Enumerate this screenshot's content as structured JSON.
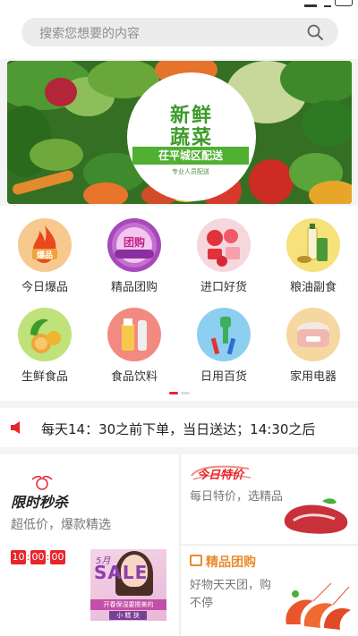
{
  "search": {
    "placeholder": "搜索您想要的内容",
    "icon": "search-icon"
  },
  "banner": {
    "line1": "新鲜",
    "line2": "蔬菜",
    "tag": "茌平城区配送",
    "small": "专业人员配送"
  },
  "categories": [
    {
      "label": "今日爆品",
      "icon": "fire-hot-icon",
      "badge": "爆品"
    },
    {
      "label": "精品团购",
      "icon": "group-buy-icon",
      "badge": "团购"
    },
    {
      "label": "进口好货",
      "icon": "imported-goods-icon"
    },
    {
      "label": "粮油副食",
      "icon": "grain-oil-icon"
    },
    {
      "label": "生鲜食品",
      "icon": "fresh-food-icon"
    },
    {
      "label": "食品饮料",
      "icon": "drinks-icon"
    },
    {
      "label": "日用百货",
      "icon": "daily-goods-icon"
    },
    {
      "label": "家用电器",
      "icon": "appliance-icon"
    }
  ],
  "notice": {
    "text": "每天14：30之前下单，当日送达；14:30之后",
    "icon": "speaker-icon"
  },
  "flash_sale": {
    "title": "限时秒杀",
    "subtitle": "超低价，爆款精选",
    "timer": {
      "hh": "10",
      "mm": "00",
      "ss": "00"
    },
    "ad": {
      "title": "5月",
      "big": "SALE",
      "bar": "开春保湿要擦美的",
      "bar2": "小 糕 抉"
    }
  },
  "daily_special": {
    "badge": "今日特价",
    "subtitle": "每日特价，选精品"
  },
  "group_buy": {
    "title": "精品团购",
    "line1": "好物天天团，购",
    "line2": "不停"
  },
  "colors": {
    "accent": "#e8242c",
    "orange": "#e98b2b",
    "green": "#3c9a2a"
  }
}
